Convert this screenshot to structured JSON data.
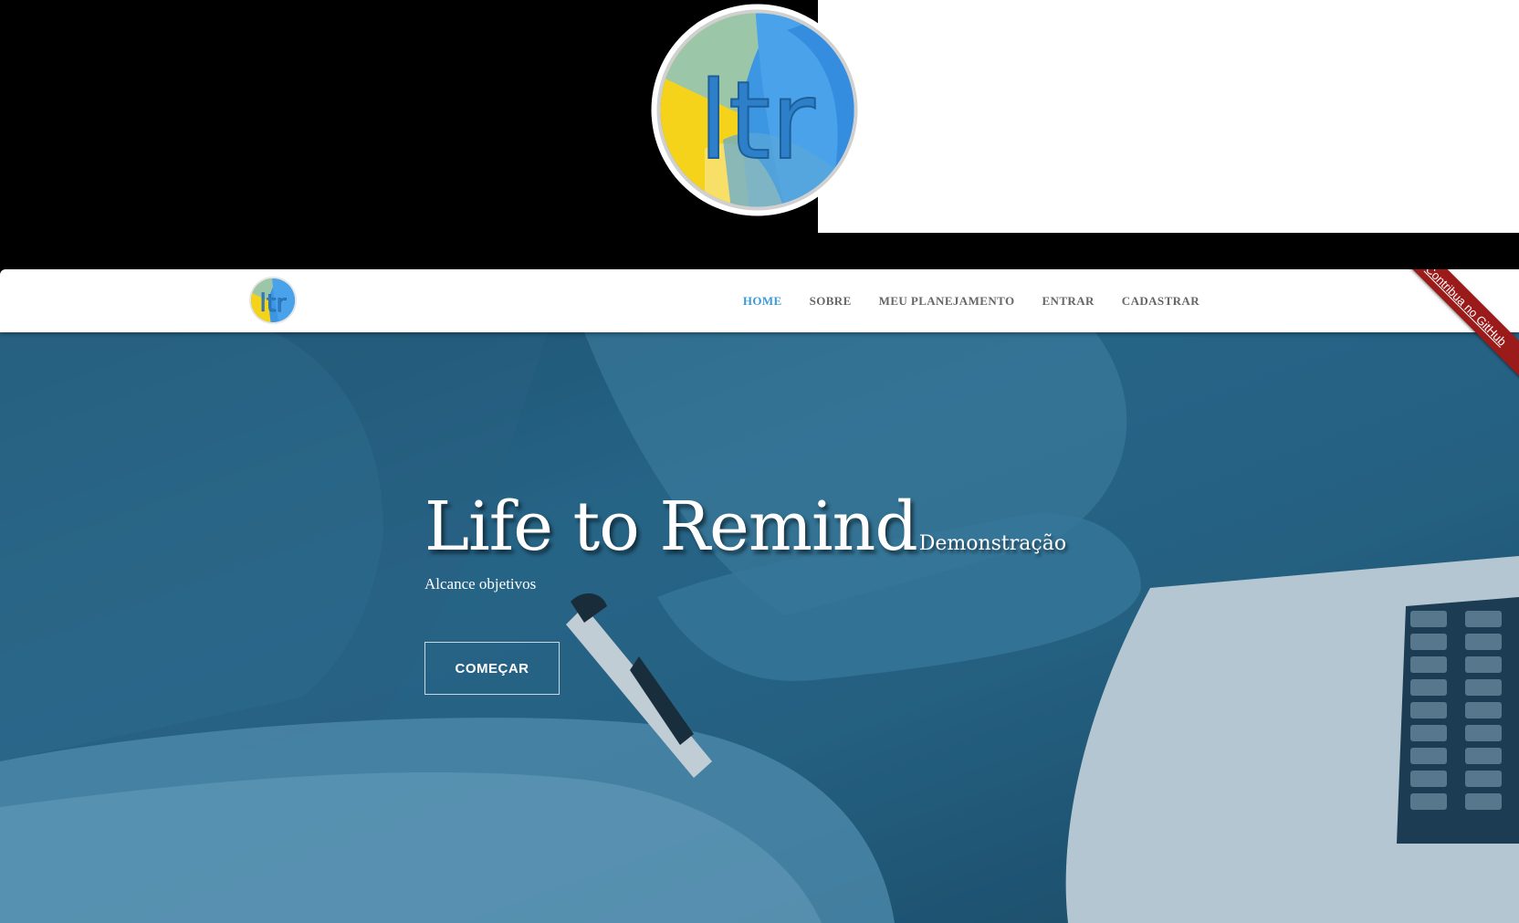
{
  "brand": {
    "logo_text": "ltr",
    "colors": {
      "primary_blue": "#3a9ad9",
      "yellow": "#f7d21a",
      "sage": "#9ec4a6",
      "ribbon_red": "#9b1b1b",
      "nav_text": "#666666"
    }
  },
  "nav": {
    "items": [
      {
        "label": "HOME",
        "active": true
      },
      {
        "label": "SOBRE",
        "active": false
      },
      {
        "label": "MEU PLANEJAMENTO",
        "active": false
      },
      {
        "label": "ENTRAR",
        "active": false
      },
      {
        "label": "CADASTRAR",
        "active": false
      }
    ]
  },
  "ribbon": {
    "label": "Contribua no GitHub"
  },
  "hero": {
    "title": "Life to Remind",
    "badge": "Demonstração",
    "subtitle": "Alcance objetivos",
    "cta_label": "COMEÇAR"
  }
}
